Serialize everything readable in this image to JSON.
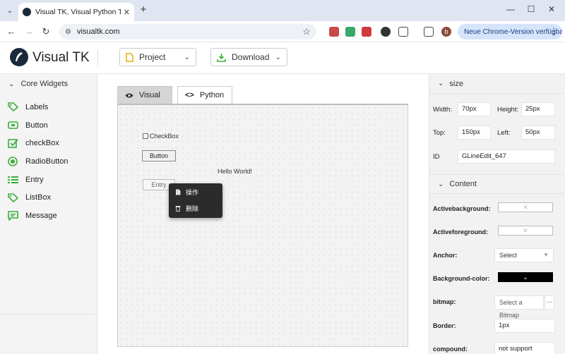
{
  "browser": {
    "tab_title": "Visual TK, Visual Python Tkinter",
    "url": "visualtk.com",
    "update_label": "Neue Chrome-Version verfügbar",
    "profile_initial": "b"
  },
  "app": {
    "logo_text": "Visual TK",
    "project_label": "Project",
    "download_label": "Download"
  },
  "sidebar": {
    "title": "Core Widgets",
    "items": [
      {
        "label": "Labels",
        "icon": "tag-icon"
      },
      {
        "label": "Button",
        "icon": "button-icon"
      },
      {
        "label": "checkBox",
        "icon": "checkbox-icon"
      },
      {
        "label": "RadioButton",
        "icon": "radio-icon"
      },
      {
        "label": "Entry",
        "icon": "list-icon"
      },
      {
        "label": "ListBox",
        "icon": "tag-icon"
      },
      {
        "label": "Message",
        "icon": "message-icon"
      }
    ]
  },
  "main": {
    "tabs": [
      {
        "label": "Visual",
        "icon": "eye-icon",
        "active": true
      },
      {
        "label": "Python",
        "icon": "code-icon",
        "active": false
      }
    ],
    "canvas": {
      "checkbox_label": "CheckBox",
      "button_label": "Button",
      "label_text": "Hello World!",
      "entry_text": "Entry"
    },
    "context_menu": [
      {
        "label": "操作",
        "icon": "file-icon"
      },
      {
        "label": "删除",
        "icon": "trash-icon"
      }
    ]
  },
  "props": {
    "size_section": "size",
    "width_label": "Width:",
    "width_value": "70px",
    "height_label": "Height:",
    "height_value": "25px",
    "top_label": "Top:",
    "top_value": "150px",
    "left_label": "Left:",
    "left_value": "50px",
    "id_label": "ID",
    "id_value": "GLineEdit_647",
    "content_section": "Content",
    "activebackground_label": "Activebackground:",
    "activeforeground_label": "Activeforeground:",
    "anchor_label": "Anchor:",
    "anchor_value": "Select",
    "bgcolor_label": "Background-color:",
    "bitmap_label": "bitmap:",
    "bitmap_placeholder": "Select a Bitmap",
    "border_label": "Border:",
    "border_value": "1px",
    "compound_label": "compound:",
    "compound_value": "not support"
  },
  "colors": {
    "accent_green": "#3cad3c",
    "logo_dark": "#1b2a3b",
    "background_color_value": "#000000"
  }
}
